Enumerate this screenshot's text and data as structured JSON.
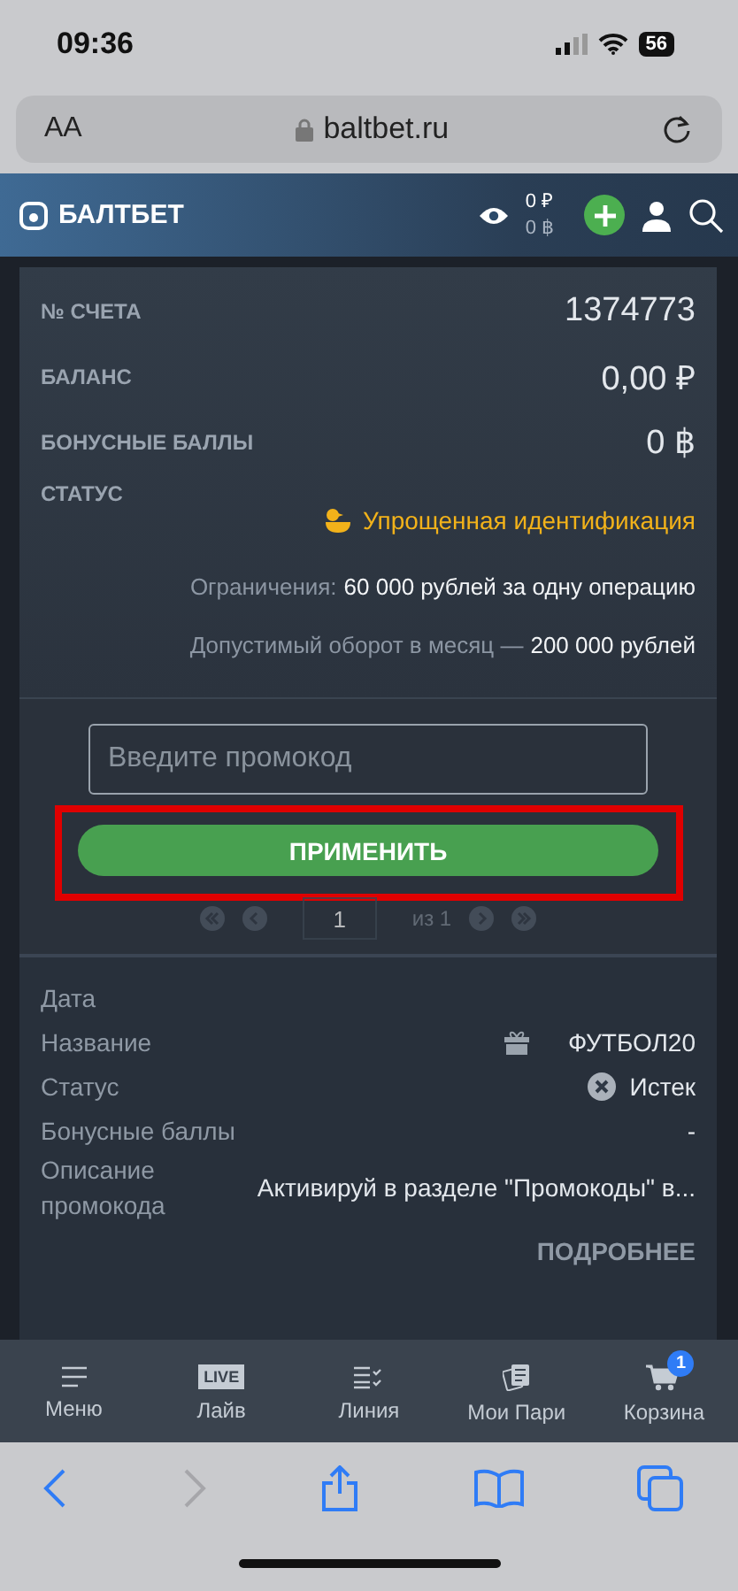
{
  "status_bar": {
    "time": "09:36",
    "battery": "56"
  },
  "browser": {
    "text_size": "AA",
    "url": "baltbet.ru"
  },
  "header": {
    "logo": "БАЛТБЕТ",
    "balance_rub": "0 ₽",
    "balance_bonus": "0 ฿"
  },
  "account": {
    "rows": [
      {
        "label": "№ СЧЕТА",
        "value": "1374773"
      },
      {
        "label": "БАЛАНС",
        "value": "0,00 ₽"
      },
      {
        "label": "БОНУСНЫЕ БАЛЛЫ",
        "value": "0 ฿"
      }
    ],
    "status_label": "СТАТУС",
    "status_value": "Упрощенная идентификация",
    "limits": [
      {
        "label": "Ограничения:",
        "value": "60 000 рублей за одну операцию"
      },
      {
        "label": "Допустимый оборот в месяц —",
        "value": "200 000 рублей"
      }
    ]
  },
  "promo": {
    "placeholder": "Введите промокод",
    "apply": "ПРИМЕНИТЬ",
    "highlighted": true,
    "page": "1",
    "of": "из 1"
  },
  "details": {
    "rows": [
      {
        "kind": "plain",
        "label": "Дата"
      },
      {
        "kind": "gift",
        "label": "Название",
        "value": "ФУТБОЛ20"
      },
      {
        "kind": "expired",
        "label": "Статус",
        "value": "Истек"
      },
      {
        "kind": "plain",
        "label": "Бонусные баллы",
        "value": "-"
      },
      {
        "kind": "plain",
        "label": "Описание промокода",
        "value": "Активируй в разделе \"Промокоды\" в..."
      }
    ],
    "more": "ПОДРОБНЕЕ"
  },
  "tabbar": [
    {
      "kind": "menu",
      "label": "Меню"
    },
    {
      "kind": "live",
      "label": "Лайв",
      "icon_text": "LIVE"
    },
    {
      "kind": "line",
      "label": "Линия"
    },
    {
      "kind": "bets",
      "label": "Мои Пари"
    },
    {
      "kind": "cart",
      "label": "Корзина",
      "badge": "1"
    }
  ]
}
